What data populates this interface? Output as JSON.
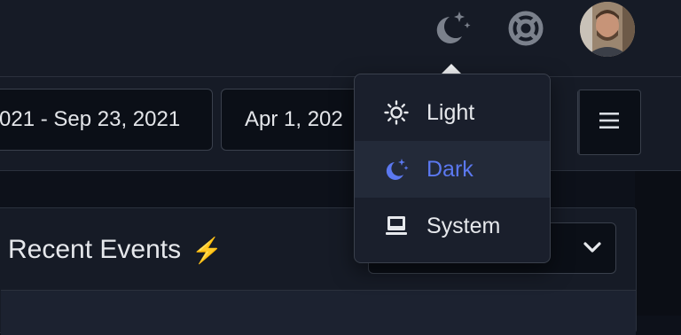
{
  "date_range": {
    "value": "021 - Sep 23, 2021"
  },
  "start_date": {
    "value": "Apr 1, 202"
  },
  "card": {
    "title": "Recent Events",
    "title_icon": "⚡"
  },
  "theme_menu": {
    "options": [
      {
        "label": "Light",
        "icon": "sun-icon",
        "selected": false
      },
      {
        "label": "Dark",
        "icon": "moon-stars-icon",
        "selected": true
      },
      {
        "label": "System",
        "icon": "monitor-icon",
        "selected": false
      }
    ]
  },
  "icons": {
    "theme_toggle": "moon-stars-icon",
    "help": "lifebuoy-icon",
    "menu": "hamburger-menu-icon",
    "select": "chevron-down-icon"
  },
  "colors": {
    "background": "#0d111a",
    "panel": "#161b26",
    "accent": "#5b78f0",
    "bolt": "#b5852b",
    "border": "#3a404c"
  }
}
